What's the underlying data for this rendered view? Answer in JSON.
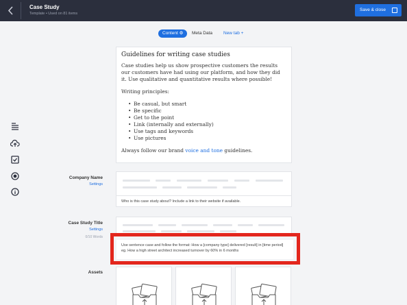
{
  "header": {
    "back_icon": "chevron-left-icon",
    "title": "Case Study",
    "subtitle": "Template • Used on 81 items",
    "save_label": "Save & close",
    "save_icon": "save-icon",
    "save_color": "#1f6fe0"
  },
  "tabs": [
    {
      "label": "Content",
      "active": true,
      "icon": "gear-icon"
    },
    {
      "label": "Meta Data"
    },
    {
      "label": "New tab",
      "icon": "plus-icon"
    }
  ],
  "guidelines": {
    "title": "Guidelines for writing case studies",
    "intro": "Case studies help us show prospective customers the results our customers have had using our platform, and how they did it. Use qualitative and quantitative results where possible!",
    "principles_heading": "Writing principles:",
    "principles": [
      "Be casual, but smart",
      "Be specific",
      "Get to the point",
      "Link (internally and externally)",
      "Use tags and keywords",
      "Use pictures"
    ],
    "footer_prefix": "Always follow our brand ",
    "footer_link": "voice and tone",
    "footer_suffix": " guidelines."
  },
  "sidebar_icons": [
    "text-align-icon",
    "cloud-upload-icon",
    "checkbox-icon",
    "radio-icon",
    "info-icon"
  ],
  "fields": {
    "company_name": {
      "label": "Company Name",
      "settings": "Settings",
      "hint": "Who is this case study about? Include a link to their website if available."
    },
    "case_study_title": {
      "label": "Case Study Title",
      "settings": "Settings",
      "word_count": "0/10 Words",
      "hint": "Use sentence case and follow the format: How a [company type] delivered [result] in [time period] eg. How a high street architect increased turnover by 60% in 6 months"
    },
    "assets": {
      "label": "Assets"
    }
  },
  "highlight_color": "#e3261d"
}
